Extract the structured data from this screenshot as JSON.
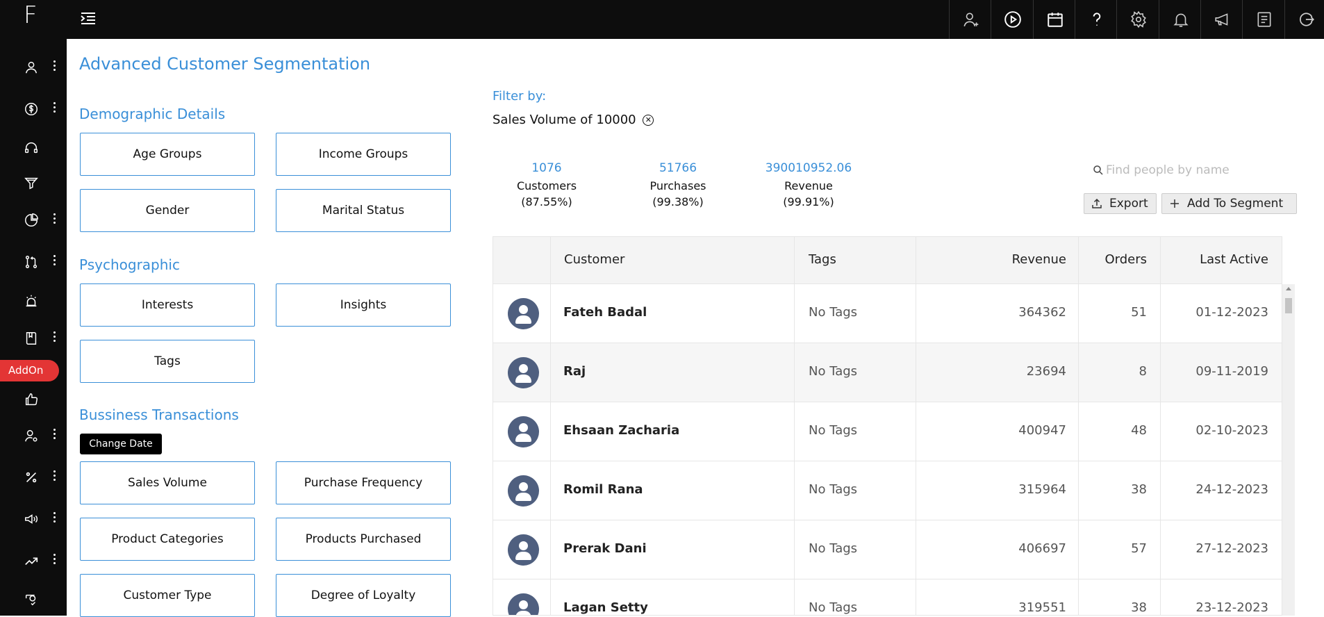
{
  "logo": "F",
  "addon_label": "AddOn",
  "page_title": "Advanced Customer Segmentation",
  "sections": {
    "demographic": {
      "title": "Demographic Details",
      "buttons": [
        "Age Groups",
        "Income Groups",
        "Gender",
        "Marital Status"
      ]
    },
    "psychographic": {
      "title": "Psychographic",
      "buttons": [
        "Interests",
        "Insights",
        "Tags"
      ]
    },
    "business": {
      "title": "Bussiness Transactions",
      "buttons": [
        "Sales Volume",
        "Purchase Frequency",
        "Product Categories",
        "Products Purchased",
        "Customer Type",
        "Degree of Loyalty"
      ]
    }
  },
  "tooltip": "Change Date",
  "filter": {
    "label": "Filter by:",
    "value": "Sales Volume of 10000",
    "remove_icon": "close-circle-icon"
  },
  "stats": [
    {
      "value": "1076",
      "label": "Customers",
      "percent": "(87.55%)"
    },
    {
      "value": "51766",
      "label": "Purchases",
      "percent": "(99.38%)"
    },
    {
      "value": "390010952.06",
      "label": "Revenue",
      "percent": "(99.91%)"
    }
  ],
  "search": {
    "placeholder": "Find people by name"
  },
  "actions": {
    "export": "Export",
    "add_to_segment": "Add To Segment"
  },
  "table": {
    "headers": {
      "customer": "Customer",
      "tags": "Tags",
      "revenue": "Revenue",
      "orders": "Orders",
      "last_active": "Last Active"
    },
    "rows": [
      {
        "name": "Fateh Badal",
        "tags": "No Tags",
        "revenue": "364362",
        "orders": "51",
        "last_active": "01-12-2023"
      },
      {
        "name": "Raj",
        "tags": "No Tags",
        "revenue": "23694",
        "orders": "8",
        "last_active": "09-11-2019"
      },
      {
        "name": "Ehsaan Zacharia",
        "tags": "No Tags",
        "revenue": "400947",
        "orders": "48",
        "last_active": "02-10-2023"
      },
      {
        "name": "Romil Rana",
        "tags": "No Tags",
        "revenue": "315964",
        "orders": "38",
        "last_active": "24-12-2023"
      },
      {
        "name": "Prerak Dani",
        "tags": "No Tags",
        "revenue": "406697",
        "orders": "57",
        "last_active": "27-12-2023"
      },
      {
        "name": "Lagan Setty",
        "tags": "No Tags",
        "revenue": "319551",
        "orders": "38",
        "last_active": "23-12-2023"
      }
    ]
  },
  "sidebar_icons": [
    "user-icon",
    "dollar-icon",
    "headset-icon",
    "funnel-icon",
    "pie-chart-icon",
    "workflow-icon",
    "alarm-icon",
    "book-icon",
    "thumbs-up-icon",
    "user-settings-icon",
    "percent-icon",
    "megaphone-icon",
    "trend-icon",
    "settings-check-icon"
  ],
  "topbar_icons": [
    "add-user-icon",
    "play-icon",
    "calendar-icon",
    "help-icon",
    "gear-icon",
    "bell-icon",
    "announcement-icon",
    "report-icon",
    "logout-icon"
  ],
  "colors": {
    "accent": "#3a8fd8",
    "sidebar": "#0d0d0d",
    "addon": "#e33535"
  }
}
